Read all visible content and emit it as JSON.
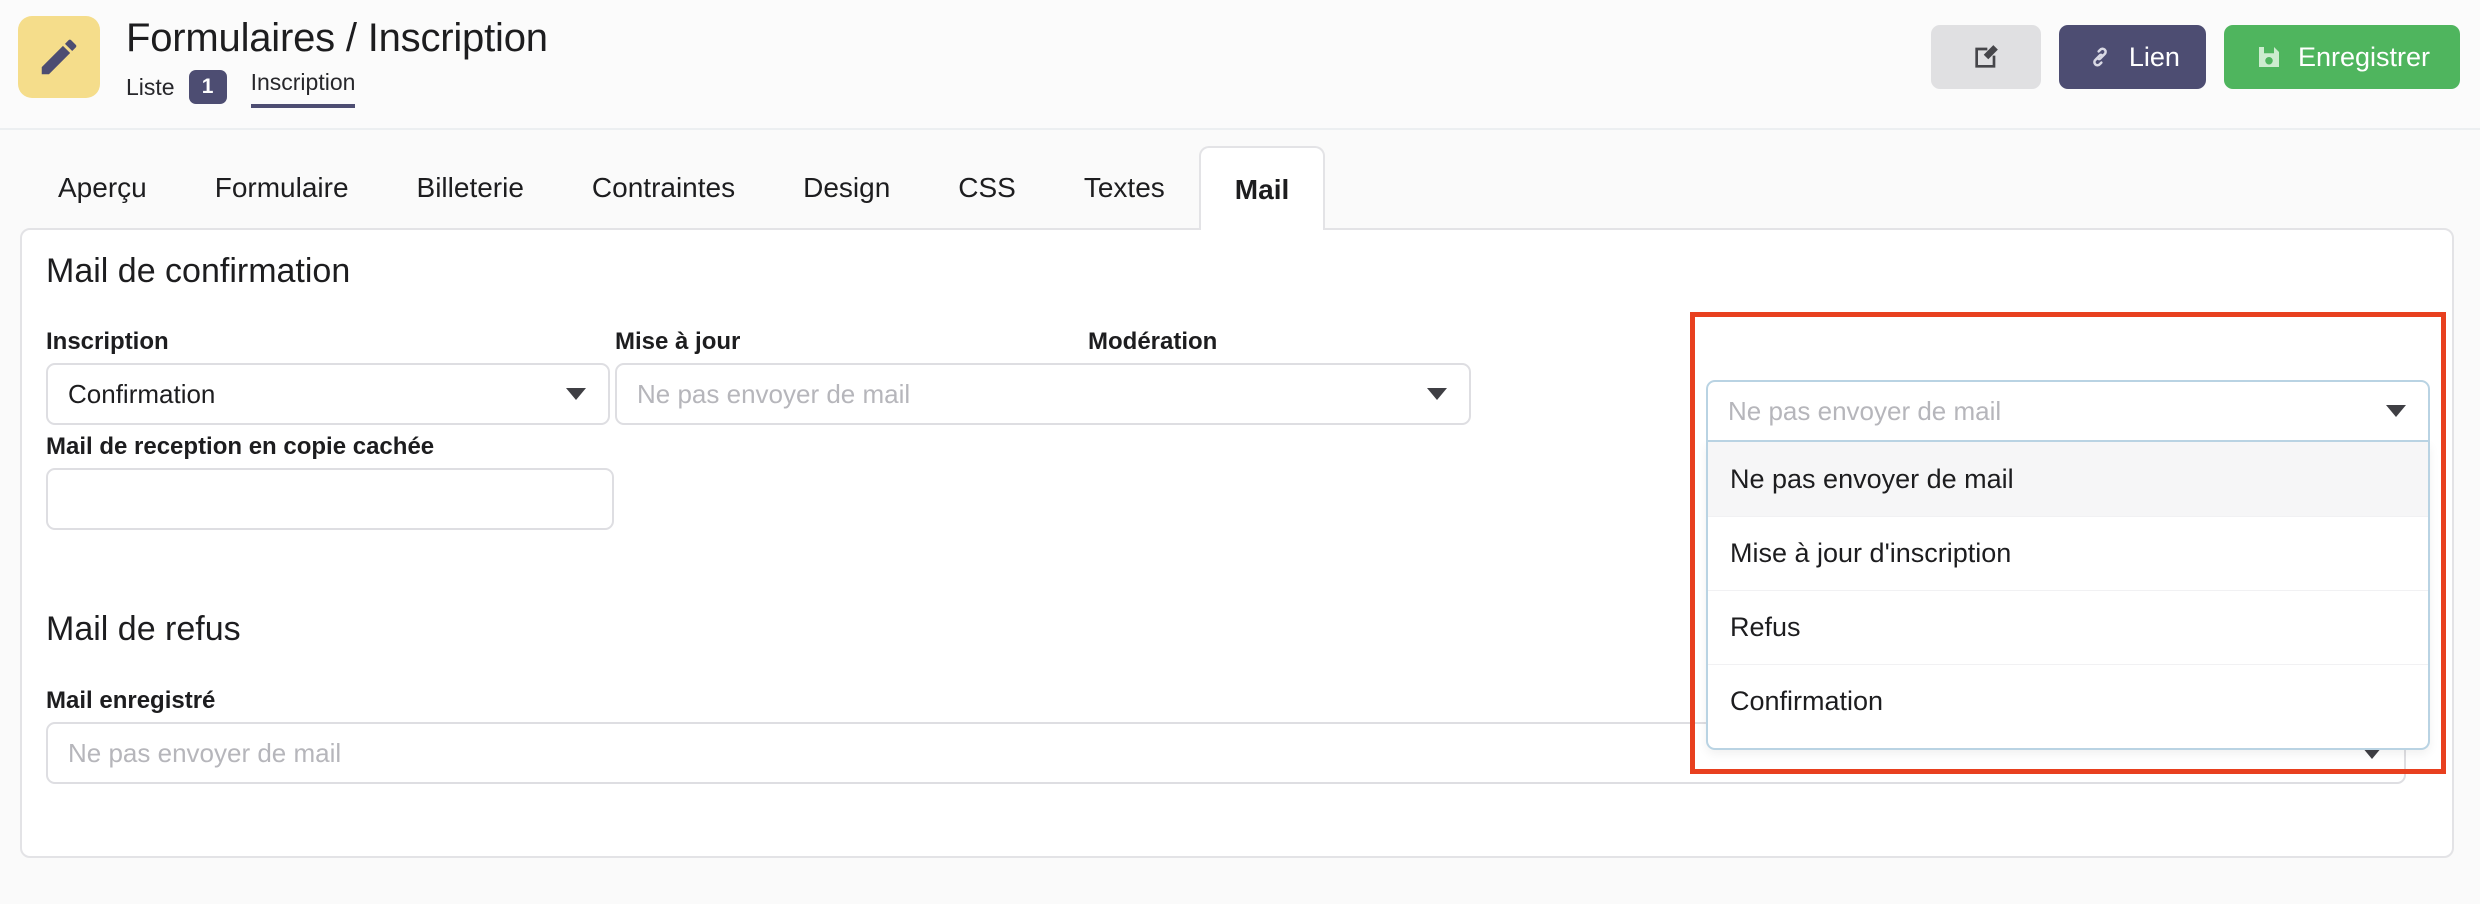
{
  "header": {
    "icon": "pencil-icon",
    "title": "Formulaires / Inscription",
    "subnav": {
      "list_label": "Liste",
      "badge_count": "1",
      "active_label": "Inscription"
    },
    "actions": {
      "edit_icon": "edit-square-icon",
      "link_label": "Lien",
      "link_icon": "link-icon",
      "save_label": "Enregistrer",
      "save_icon": "floppy-disk-icon"
    }
  },
  "tabs": [
    {
      "label": "Aperçu",
      "active": false
    },
    {
      "label": "Formulaire",
      "active": false
    },
    {
      "label": "Billeterie",
      "active": false
    },
    {
      "label": "Contraintes",
      "active": false
    },
    {
      "label": "Design",
      "active": false
    },
    {
      "label": "CSS",
      "active": false
    },
    {
      "label": "Textes",
      "active": false
    },
    {
      "label": "Mail",
      "active": true
    }
  ],
  "main": {
    "section_confirmation": {
      "title": "Mail de confirmation",
      "inscription": {
        "label": "Inscription",
        "value": "Confirmation"
      },
      "mise_a_jour": {
        "label": "Mise à jour",
        "placeholder": "Ne pas envoyer de mail"
      },
      "moderation": {
        "label": "Modération",
        "placeholder": "Ne pas envoyer de mail",
        "options": [
          "Ne pas envoyer de mail",
          "Mise à jour d'inscription",
          "Refus",
          "Confirmation"
        ],
        "highlighted_option": "Ne pas envoyer de mail"
      },
      "copie_cachee": {
        "label": "Mail de reception en copie cachée",
        "value": ""
      }
    },
    "section_refus": {
      "title": "Mail de refus",
      "mail_enregistre": {
        "label": "Mail enregistré",
        "placeholder": "Ne pas envoyer de mail"
      }
    }
  },
  "colors": {
    "accent_purple": "#4d4d72",
    "icon_yellow": "#f5dd8b",
    "save_green": "#4fb55e",
    "highlight_red": "#e8401f",
    "focus_blue": "#b9d3e3"
  }
}
